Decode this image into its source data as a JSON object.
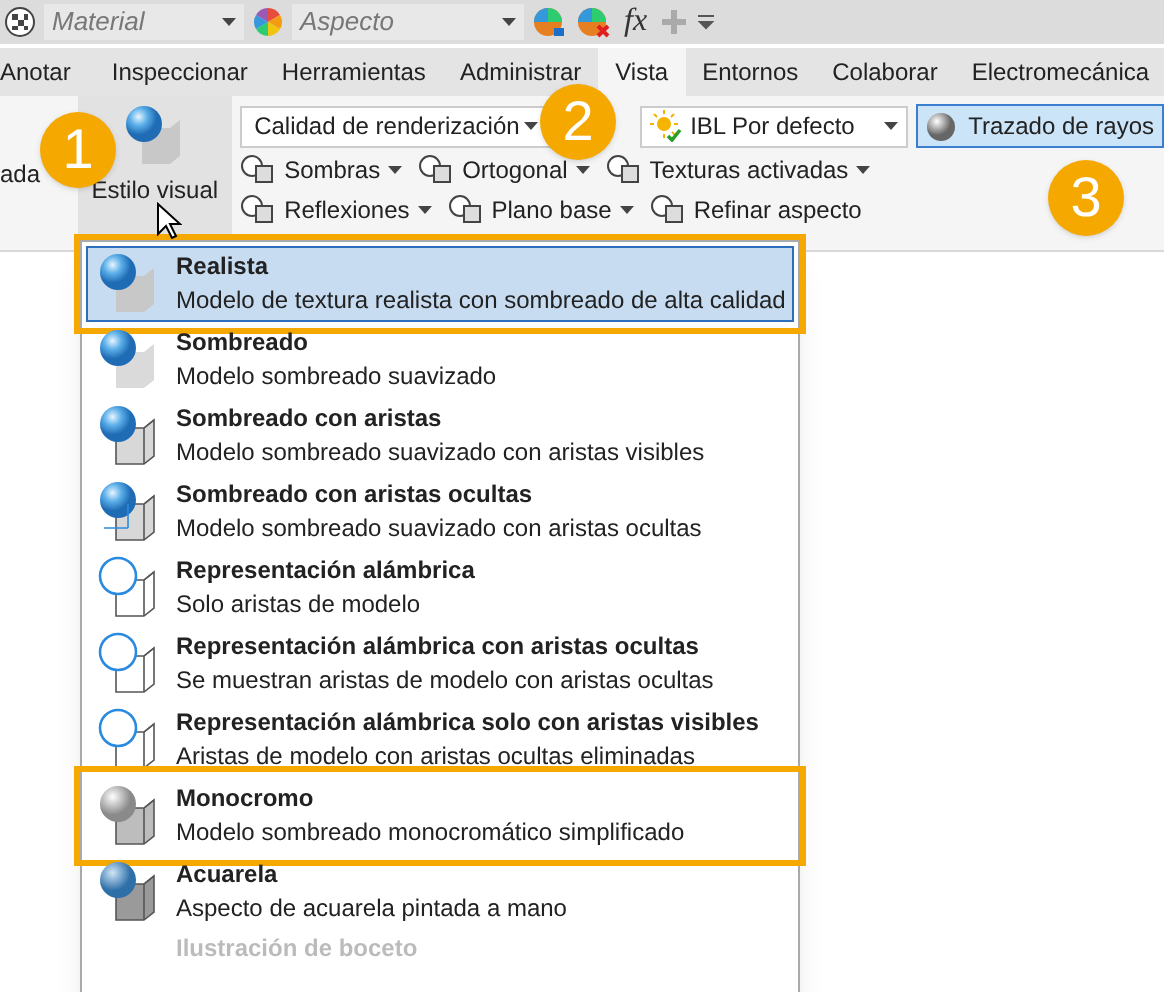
{
  "quick_access": {
    "material": {
      "placeholder": "Material"
    },
    "appearance": {
      "placeholder": "Aspecto"
    },
    "formula": "fx"
  },
  "tabs": [
    {
      "label": "Anotar",
      "selected": false
    },
    {
      "label": "Inspeccionar",
      "selected": false
    },
    {
      "label": "Herramientas",
      "selected": false
    },
    {
      "label": "Administrar",
      "selected": false
    },
    {
      "label": "Vista",
      "selected": true
    },
    {
      "label": "Entornos",
      "selected": false
    },
    {
      "label": "Colaborar",
      "selected": false
    },
    {
      "label": "Electromecánica",
      "selected": false
    }
  ],
  "ribbon": {
    "left_cut": "ada",
    "visual_style": {
      "label": "Estilo visual",
      "open": true
    },
    "render_quality": "Calidad de renderización",
    "ibl": "IBL Por defecto",
    "ray_tracing": {
      "label": "Trazado de rayos",
      "pressed": true
    },
    "row2": [
      {
        "label": "Sombras",
        "dropdown": true
      },
      {
        "label": "Ortogonal",
        "dropdown": true
      },
      {
        "label": "Texturas activadas",
        "dropdown": true
      }
    ],
    "row3": [
      {
        "label": "Reflexiones",
        "dropdown": true
      },
      {
        "label": "Plano base",
        "dropdown": true
      },
      {
        "label": "Refinar aspecto",
        "dropdown": false
      }
    ]
  },
  "callouts": [
    "1",
    "2",
    "3"
  ],
  "menu": [
    {
      "title": "Realista",
      "description": "Modelo de textura realista con sombreado de alta calidad",
      "kind": "realistic",
      "selected": true,
      "outlined": true
    },
    {
      "title": "Sombreado",
      "description": "Modelo sombreado suavizado",
      "kind": "shaded",
      "selected": false,
      "outlined": false
    },
    {
      "title": "Sombreado con aristas",
      "description": "Modelo sombreado suavizado con aristas visibles",
      "kind": "shaded-edges",
      "selected": false,
      "outlined": false
    },
    {
      "title": "Sombreado con aristas ocultas",
      "description": "Modelo sombreado suavizado con aristas ocultas",
      "kind": "shaded-hidden",
      "selected": false,
      "outlined": false
    },
    {
      "title": "Representación alámbrica",
      "description": "Solo aristas de modelo",
      "kind": "wire",
      "selected": false,
      "outlined": false
    },
    {
      "title": "Representación alámbrica con aristas ocultas",
      "description": "Se muestran aristas de modelo con aristas ocultas",
      "kind": "wire-hidden",
      "selected": false,
      "outlined": false
    },
    {
      "title": "Representación alámbrica solo con aristas visibles",
      "description": "Aristas de modelo con aristas ocultas eliminadas",
      "kind": "wire",
      "selected": false,
      "outlined": false
    },
    {
      "title": "Monocromo",
      "description": "Modelo sombreado monocromático simplificado",
      "kind": "mono",
      "selected": false,
      "outlined": true
    },
    {
      "title": "Acuarela",
      "description": "Aspecto de acuarela pintada a mano",
      "kind": "watercolor",
      "selected": false,
      "outlined": false
    },
    {
      "title": "Ilustración de boceto",
      "kind": "faded",
      "selected": false,
      "outlined": false
    }
  ]
}
